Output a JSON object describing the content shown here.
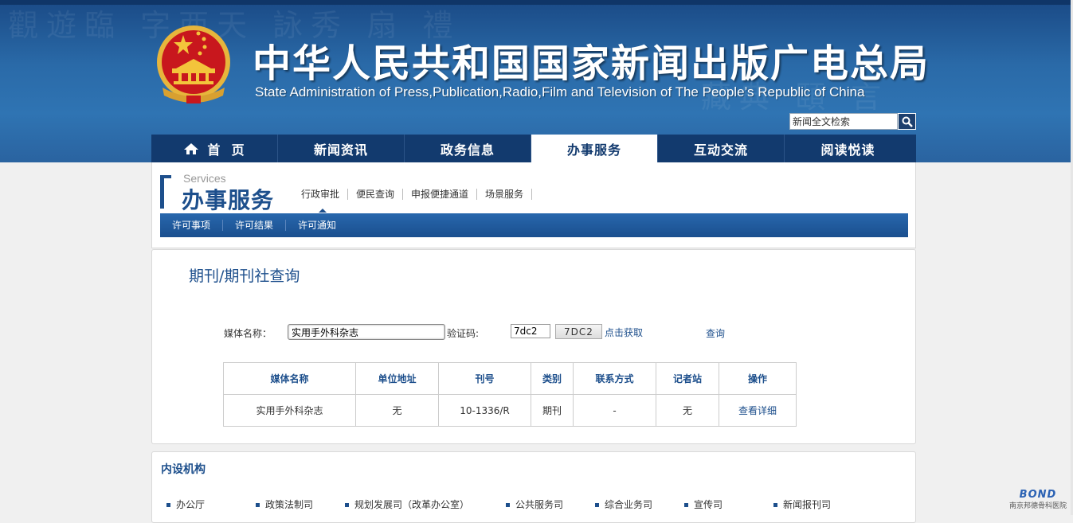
{
  "header": {
    "title_cn": "中华人民共和国国家新闻出版广电总局",
    "title_en": "State Administration of Press,Publication,Radio,Film and Television of The People’s Republic of China",
    "search_placeholder": "新闻全文检索"
  },
  "nav": {
    "items": [
      {
        "label": "首  页"
      },
      {
        "label": "新闻资讯"
      },
      {
        "label": "政务信息"
      },
      {
        "label": "办事服务"
      },
      {
        "label": "互动交流"
      },
      {
        "label": "阅读悦读"
      }
    ],
    "active_index": 3
  },
  "section": {
    "en": "Services",
    "cn": "办事服务",
    "subnav": [
      "行政审批",
      "便民查询",
      "申报便捷通道",
      "场景服务"
    ],
    "subtabs": [
      "许可事项",
      "许可结果",
      "许可通知"
    ]
  },
  "query_page": {
    "title": "期刊/期刊社查询",
    "media_label": "媒体名称：",
    "media_value": "实用手外科杂志",
    "captcha_label": "验证码:",
    "captcha_value": "7dc2",
    "captcha_image_text": "7DC2",
    "get_code_label": "点击获取",
    "query_label": "查询"
  },
  "results": {
    "headers": [
      "媒体名称",
      "单位地址",
      "刊号",
      "类别",
      "联系方式",
      "记者站",
      "操作"
    ],
    "rows": [
      [
        "实用手外科杂志",
        "无",
        "10-1336/R",
        "期刊",
        "-",
        "无",
        "查看详细"
      ]
    ]
  },
  "departments": {
    "title": "内设机构",
    "items": [
      "办公厅",
      "政策法制司",
      "规划发展司（改革办公室）",
      "公共服务司",
      "综合业务司",
      "宣传司",
      "新闻报刊司"
    ]
  },
  "watermark": {
    "brand": "BOND",
    "sub": "南京邦德骨科医院"
  },
  "colors": {
    "brand_blue": "#1d4f8c",
    "nav_bg": "#123a6e",
    "banner_blue": "#2f74b3"
  }
}
